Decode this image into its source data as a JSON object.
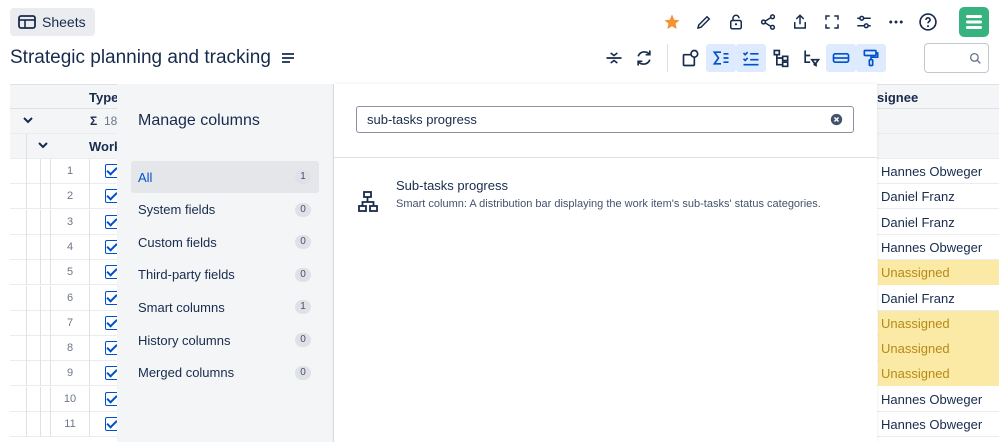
{
  "header": {
    "app_button_label": "Sheets",
    "page_title": "Strategic planning and tracking",
    "top_icons": [
      "star-icon",
      "pencil-icon",
      "lock-icon",
      "share-icon",
      "export-icon",
      "fullscreen-icon",
      "settings-sliders-icon",
      "more-icon",
      "help-icon"
    ],
    "toolbar_icons": [
      "collapse-rows-icon",
      "refresh-icon",
      "add-view-icon",
      "sum-icon",
      "checklist-icon",
      "hierarchy-icon",
      "hierarchy-filter-icon",
      "row-format-icon",
      "paint-format-icon"
    ],
    "search_placeholder": ""
  },
  "colors": {
    "accent": "#0052cc",
    "brand": "#36b37e",
    "star": "#f79232",
    "unassigned_bg": "#fbe9a6",
    "unassigned_text": "#b68a16"
  },
  "grid": {
    "header_type": "Type",
    "header_assignee": "signee",
    "sum_row_value": "18",
    "group_label": "Work",
    "rows": [
      {
        "num": "1",
        "assignee": "Hannes Obweger",
        "unassigned": false
      },
      {
        "num": "2",
        "assignee": "Daniel Franz",
        "unassigned": false
      },
      {
        "num": "3",
        "assignee": "Daniel Franz",
        "unassigned": false
      },
      {
        "num": "4",
        "assignee": "Hannes Obweger",
        "unassigned": false
      },
      {
        "num": "5",
        "assignee": "Unassigned",
        "unassigned": true
      },
      {
        "num": "6",
        "assignee": "Daniel Franz",
        "unassigned": false
      },
      {
        "num": "7",
        "assignee": "Unassigned",
        "unassigned": true
      },
      {
        "num": "8",
        "assignee": "Unassigned",
        "unassigned": true
      },
      {
        "num": "9",
        "assignee": "Unassigned",
        "unassigned": true
      },
      {
        "num": "10",
        "assignee": "Hannes Obweger",
        "unassigned": false
      },
      {
        "num": "11",
        "assignee": "Hannes Obweger",
        "unassigned": false
      }
    ]
  },
  "manage_columns": {
    "title": "Manage columns",
    "search_value": "sub-tasks progress",
    "categories": [
      {
        "label": "All",
        "count": "1",
        "selected": true
      },
      {
        "label": "System fields",
        "count": "0"
      },
      {
        "label": "Custom fields",
        "count": "0"
      },
      {
        "label": "Third-party fields",
        "count": "0"
      },
      {
        "label": "Smart columns",
        "count": "1"
      },
      {
        "label": "History columns",
        "count": "0"
      },
      {
        "label": "Merged columns",
        "count": "0"
      }
    ],
    "result": {
      "title": "Sub-tasks progress",
      "description": "Smart column: A distribution bar displaying the work item's sub-tasks' status categories."
    }
  }
}
